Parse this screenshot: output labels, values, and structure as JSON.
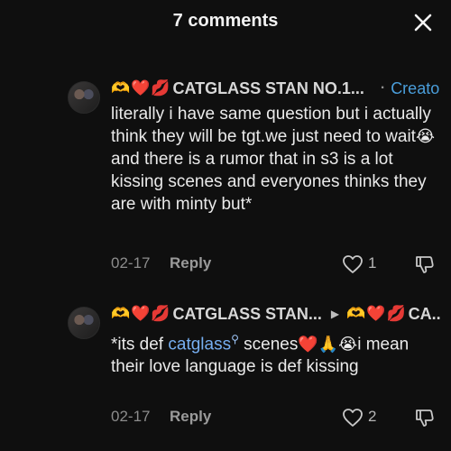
{
  "header": {
    "title": "7 comments",
    "close_icon": "close-icon"
  },
  "comments": [
    {
      "emojis": [
        "🫶",
        "❤️",
        "💋"
      ],
      "username": "CATGLASS STAN NO.1...",
      "dot": "·",
      "badge": "Creator",
      "text_parts": [
        "literally i have same question but i actually think they will be tgt.we just need to wait",
        "😭",
        "and there is a rumor that in s3 is a lot kissing scenes and everyones thinks they are with minty but*"
      ],
      "date": "02-17",
      "reply_label": "Reply",
      "likes": "1",
      "icons": {
        "like": "heart-outline-icon",
        "dislike": "thumbs-down-icon"
      }
    },
    {
      "emojis": [
        "🫶",
        "❤️",
        "💋"
      ],
      "username": "CATGLASS STAN...",
      "reply_to_emojis": [
        "🫶",
        "❤️",
        "💋"
      ],
      "reply_to": "CA...",
      "text_parts": {
        "a": "*its def ",
        "link": "catglass",
        "link_icon": "search-icon",
        "b": " scenes",
        "emojis": "❤️🙏😭",
        "c": "i mean their love language is def kissing"
      },
      "date": "02-17",
      "reply_label": "Reply",
      "likes": "2",
      "icons": {
        "like": "heart-outline-icon",
        "dislike": "thumbs-down-icon"
      }
    }
  ],
  "colors": {
    "background": "#0f0f0f",
    "creator": "#4a9edb",
    "link": "#76aef0"
  }
}
